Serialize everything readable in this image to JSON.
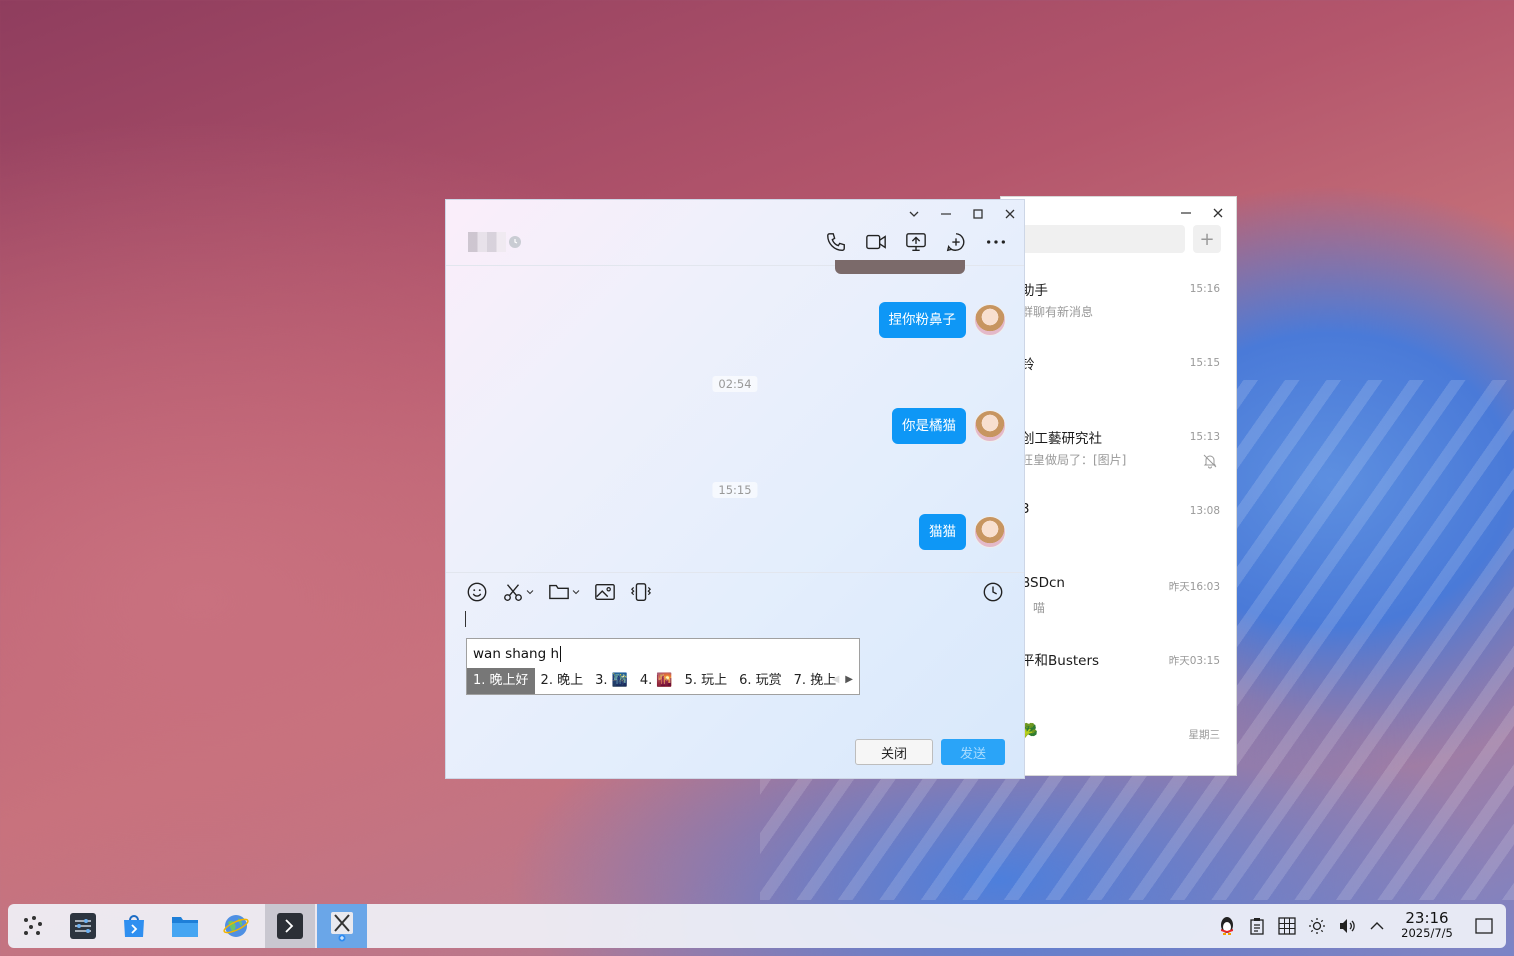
{
  "colors": {
    "accent": "#0e97f6",
    "send": "#2aa4f8",
    "taskbar": "#f0f2f8"
  },
  "list_window": {
    "items": [
      {
        "name": "助手",
        "time": "15:16",
        "preview": "群聊有新消息",
        "muted": false
      },
      {
        "name": "铃",
        "time": "15:15",
        "preview": "",
        "muted": false
      },
      {
        "name": "创工藝研究社",
        "time": "15:13",
        "preview": "旺皇做局了：[图片]",
        "muted": true
      },
      {
        "name": "3",
        "time": "13:08",
        "preview": "",
        "muted": false
      },
      {
        "name": "BSDcn",
        "time": "昨天16:03",
        "preview": "：喵",
        "muted": false
      },
      {
        "name": "平和Busters",
        "time": "昨天03:15",
        "preview": "、",
        "muted": false
      },
      {
        "name": "🥦",
        "time": "星期三",
        "preview": "",
        "muted": false
      }
    ],
    "plus_label": "+"
  },
  "chat": {
    "messages": [
      {
        "text": "捏你粉鼻子"
      },
      {
        "time": "02:54"
      },
      {
        "text": "你是橘猫"
      },
      {
        "time": "15:15"
      },
      {
        "text": "猫猫"
      }
    ],
    "msg1": "捏你粉鼻子",
    "time1": "02:54",
    "msg2": "你是橘猫",
    "time2": "15:15",
    "msg3": "猫猫",
    "ime": {
      "input": "wan shang h",
      "candidates": [
        "1. 晚上好",
        "2. 晚上",
        "3. 🌃",
        "4. 🌇",
        "5. 玩上",
        "6. 玩赏",
        "7. 挽上"
      ]
    },
    "close_label": "关闭",
    "send_label": "发送"
  },
  "taskbar": {
    "time": "23:16",
    "date": "2025/7/5"
  }
}
